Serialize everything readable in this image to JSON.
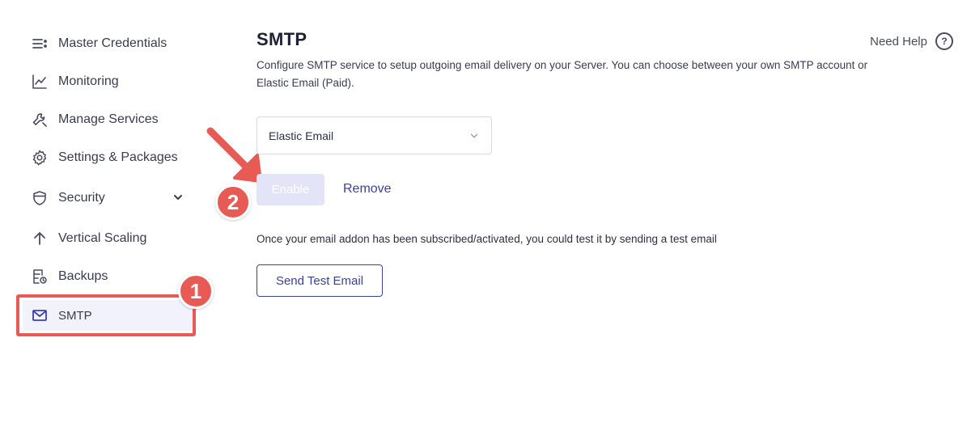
{
  "sidebar": {
    "items": [
      {
        "label": "Master Credentials",
        "icon": "list-icon"
      },
      {
        "label": "Monitoring",
        "icon": "chart-line-icon"
      },
      {
        "label": "Manage Services",
        "icon": "wrench-icon"
      },
      {
        "label": "Settings & Packages",
        "icon": "gear-icon"
      },
      {
        "label": "Security",
        "icon": "shield-icon"
      },
      {
        "label": "Vertical Scaling",
        "icon": "arrow-up-icon"
      },
      {
        "label": "Backups",
        "icon": "backup-icon"
      },
      {
        "label": "SMTP",
        "icon": "mail-icon",
        "active": true
      }
    ]
  },
  "annotations": {
    "step1": "1",
    "step2": "2",
    "color": "#e85b55"
  },
  "header": {
    "title": "SMTP",
    "description": "Configure SMTP service to setup outgoing email delivery on your Server. You can choose between your own SMTP account or Elastic Email (Paid).",
    "need_help": "Need Help",
    "help_icon_glyph": "?"
  },
  "smtp": {
    "provider_selected": "Elastic Email",
    "enable_label": "Enable",
    "remove_label": "Remove",
    "test_hint": "Once your email addon has been subscribed/activated, you could test it by sending a test email",
    "send_test_label": "Send Test Email"
  },
  "colors": {
    "accent": "#3b3fa0",
    "active_bg": "#f1f2fb",
    "disabled_bg": "#e3e4f7"
  }
}
